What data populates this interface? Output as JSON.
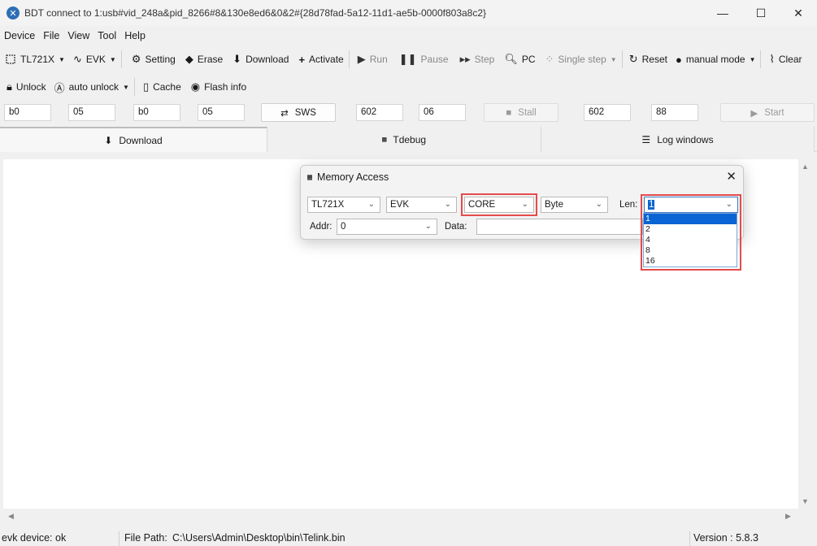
{
  "window": {
    "title": "BDT connect to 1:usb#vid_248a&pid_8266#8&130e8ed6&0&2#{28d78fad-5a12-11d1-ae5b-0000f803a8c2}",
    "minimize": "—",
    "maximize": "☐",
    "close": "✕"
  },
  "menu": [
    "Device",
    "File",
    "View",
    "Tool",
    "Help"
  ],
  "toolbar1": {
    "chip": "TL721X",
    "board": "EVK",
    "setting": "Setting",
    "erase": "Erase",
    "download": "Download",
    "activate": "Activate",
    "run": "Run",
    "pause": "Pause",
    "step": "Step",
    "pc": "PC",
    "single_step": "Single step",
    "reset": "Reset",
    "manual_mode": "manual mode",
    "clear": "Clear"
  },
  "toolbar2": {
    "unlock": "Unlock",
    "auto_unlock": "auto unlock",
    "cache": "Cache",
    "flash_info": "Flash info"
  },
  "fields": {
    "f1": "b0",
    "f2": "05",
    "f3": "b0",
    "f4": "05",
    "sws": "SWS",
    "f5": "602",
    "f6": "06",
    "stall": "Stall",
    "f7": "602",
    "f8": "88",
    "start": "Start"
  },
  "tabs": {
    "download": "Download",
    "tdebug": "Tdebug",
    "log": "Log windows"
  },
  "status": {
    "device": "evk device: ok",
    "file_path_label": "File Path:",
    "file_path": "C:\\Users\\Admin\\Desktop\\bin\\Telink.bin",
    "version": "Version : 5.8.3"
  },
  "dialog": {
    "title": "Memory Access",
    "chip": "TL721X",
    "board": "EVK",
    "region": "CORE",
    "unit": "Byte",
    "len_label": "Len:",
    "len_value": "1",
    "addr_label": "Addr:",
    "addr_value": "0",
    "data_label": "Data:",
    "data_value": "",
    "len_options": [
      "1",
      "2",
      "4",
      "8",
      "16"
    ]
  },
  "colors": {
    "highlight": "#e54b4b",
    "selection": "#0a64d3"
  }
}
